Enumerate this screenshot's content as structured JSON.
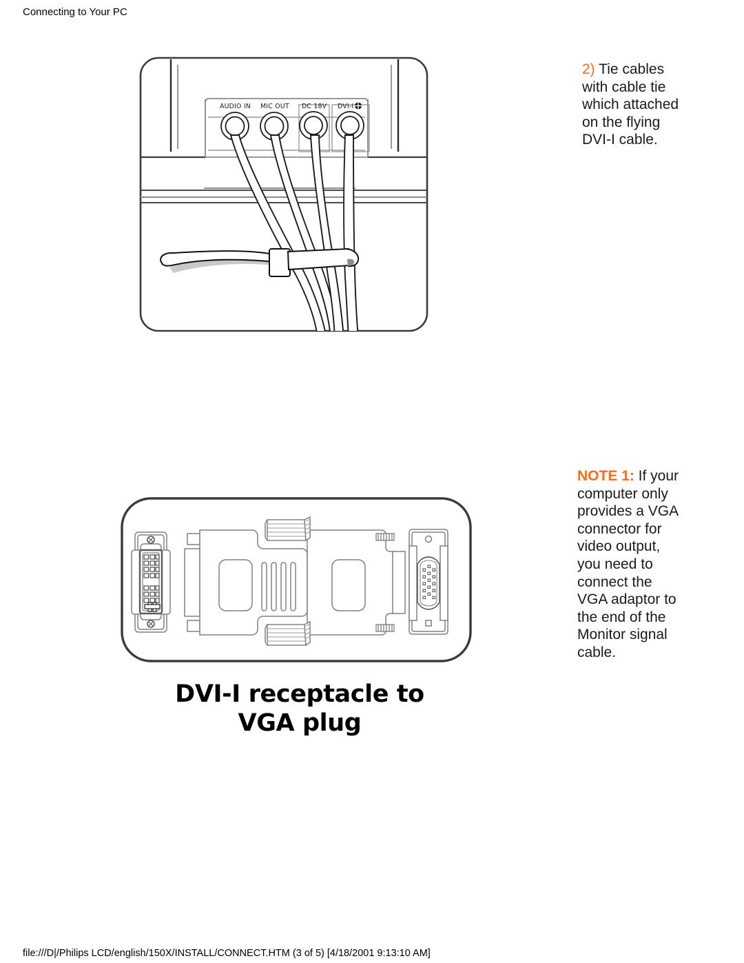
{
  "header": {
    "title": "Connecting to Your PC"
  },
  "footer": {
    "path": "file:///D|/Philips LCD/english/150X/INSTALL/CONNECT.HTM (3 of 5) [4/18/2001 9:13:10 AM]"
  },
  "colors": {
    "accent": "#ff6a14",
    "text": "#000000",
    "line": "#1a1a1a",
    "background": "#ffffff"
  },
  "step": {
    "number": "2)",
    "body": " Tie cables with cable tie which attached on the flying DVI-I cable."
  },
  "note": {
    "label": "NOTE 1:",
    "body": " If your computer only provides a VGA connector for video output, you need to connect the VGA adaptor to the end of the Monitor signal cable."
  },
  "figure_monitor": {
    "name": "monitor-rear-with-cable-tie",
    "port_labels": [
      "AUDIO IN",
      "MIC OUT",
      "DC 18V",
      "DVI-I"
    ],
    "elements": [
      "monitor-housing",
      "connector-panel",
      "four-cables",
      "cable-tie"
    ]
  },
  "figure_adapter": {
    "name": "dvi-i-to-vga-adapter",
    "caption_line1": "DVI-I receptacle to",
    "caption_line2": "VGA plug",
    "elements": [
      "dvi-i-receptacle",
      "adapter-body",
      "thumbscrews",
      "grip-ridges",
      "vga-plug"
    ]
  }
}
